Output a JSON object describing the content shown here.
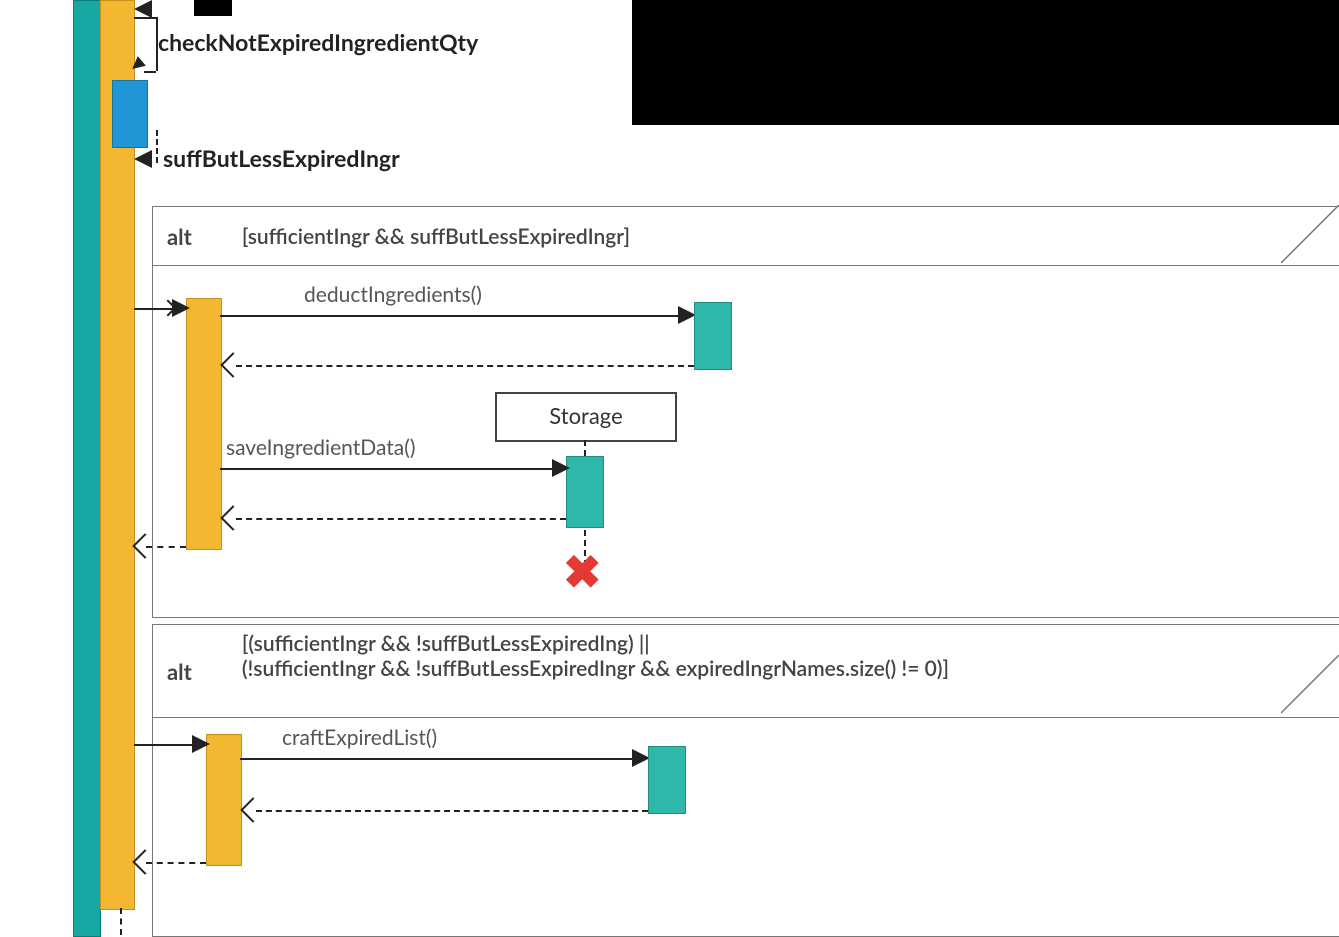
{
  "messages": {
    "checkNotExpired": "checkNotExpiredIngredientQty",
    "suffButLess": "suffButLessExpiredIngr",
    "deduct": "deductIngredients()",
    "saveData": "saveIngredientData()",
    "craftExpired": "craftExpiredList()"
  },
  "participant": {
    "storage": "Storage"
  },
  "frames": {
    "alt1": {
      "tag": "alt",
      "guard": "[sufficientIngr && suffButLessExpiredIngr]"
    },
    "alt2": {
      "tag": "alt",
      "guard1": "[(sufficientIngr && !suffButLessExpiredIng) ||",
      "guard2": "(!sufficientIngr && !suffButLessExpiredIngr && expiredIngrNames.size() != 0)]"
    }
  }
}
